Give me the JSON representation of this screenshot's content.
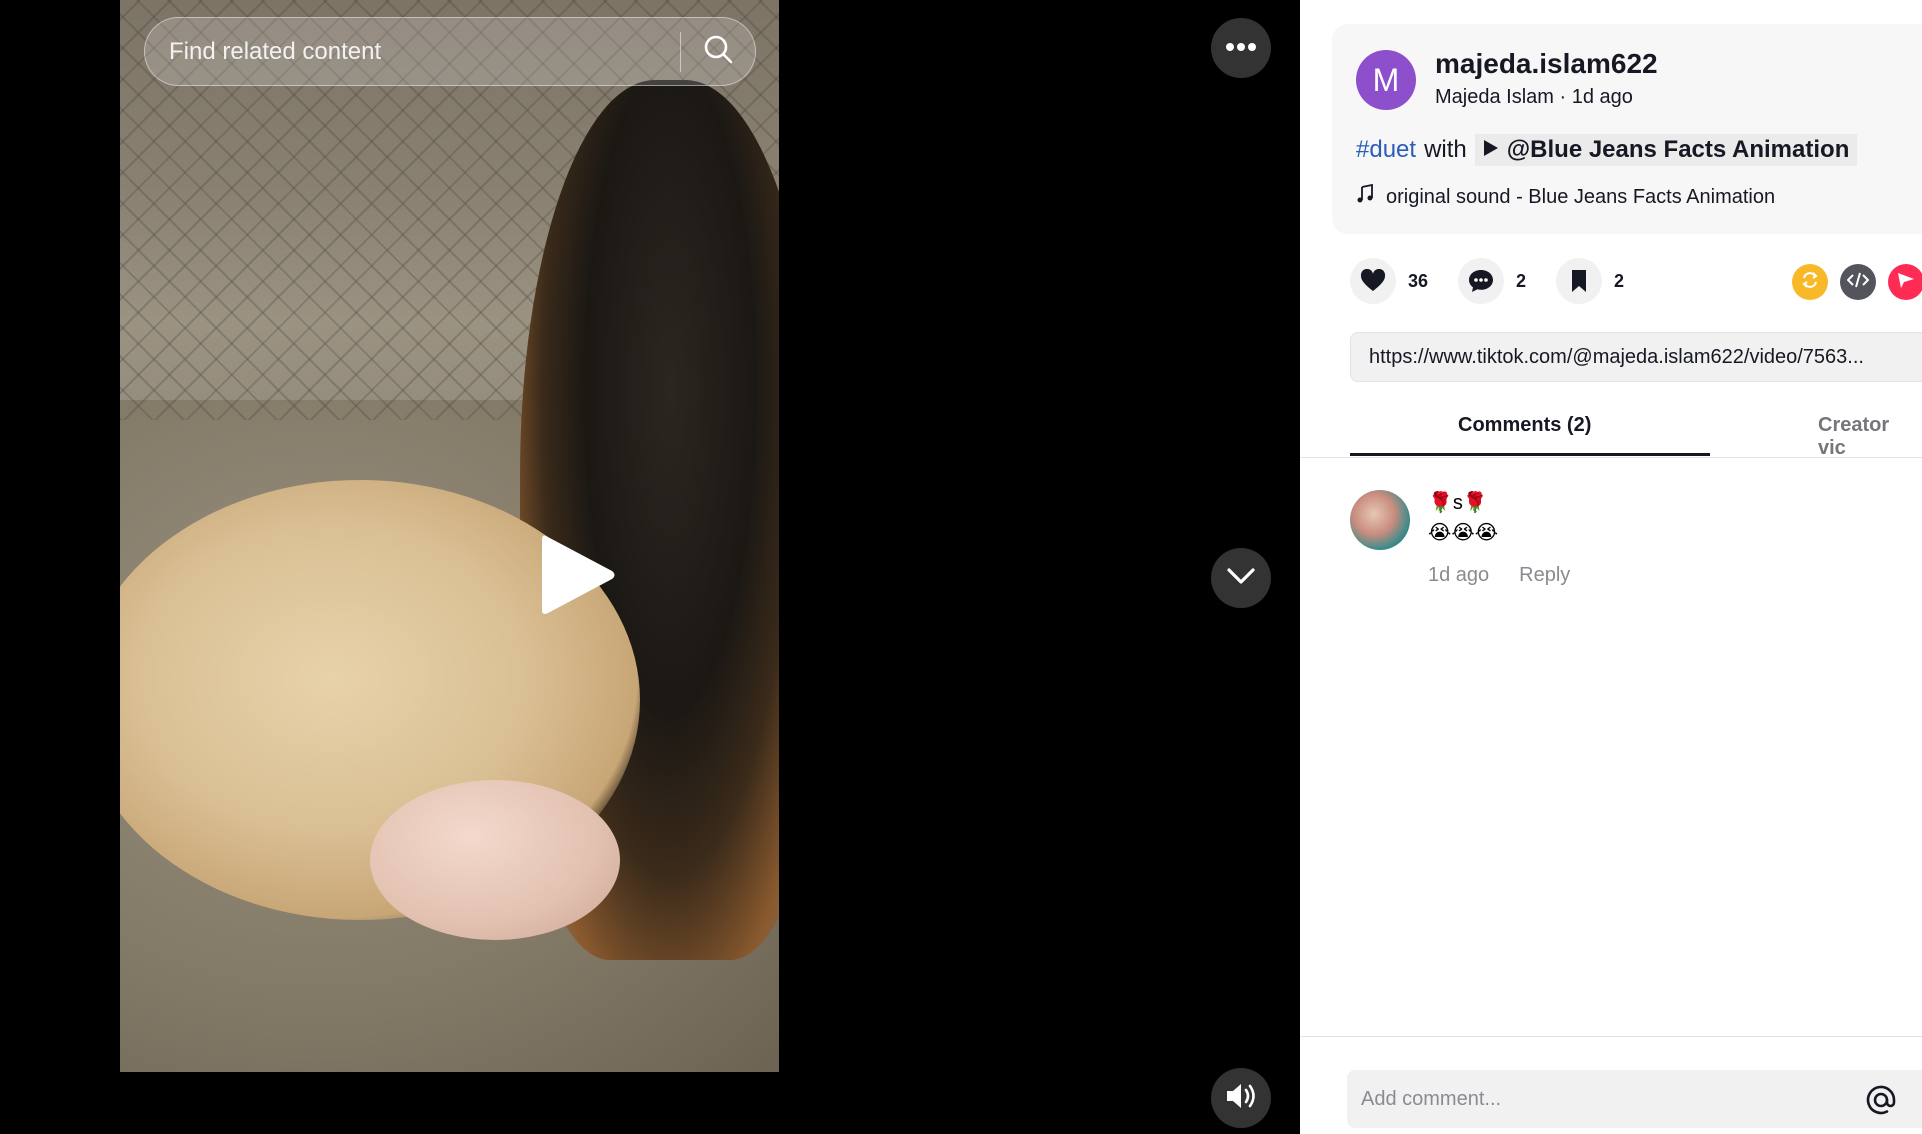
{
  "search": {
    "placeholder": "Find related content"
  },
  "post": {
    "avatar_letter": "M",
    "username": "majeda.islam622",
    "display_name": "Majeda Islam",
    "separator": " · ",
    "time": "1d ago",
    "hashtag": "#duet",
    "with_text": "with",
    "duet_user": "@Blue Jeans Facts Animation",
    "sound": "original sound - Blue Jeans Facts Animation",
    "link": "https://www.tiktok.com/@majeda.islam622/video/7563..."
  },
  "stats": {
    "likes": "36",
    "comments": "2",
    "saves": "2"
  },
  "tabs": [
    {
      "label": "Comments (2)",
      "active": true
    },
    {
      "label": "Creator vic",
      "active": false
    }
  ],
  "comments": [
    {
      "name": "🌹s🌹",
      "text": "😭😭😭",
      "time": "1d ago",
      "reply_label": "Reply"
    }
  ],
  "composer": {
    "placeholder": "Add comment..."
  },
  "colors": {
    "accent_hashtag": "#2b5db9",
    "avatar_bg": "#8d4fcb",
    "repost": "#f7b928",
    "share_red": "#fe2c55"
  }
}
